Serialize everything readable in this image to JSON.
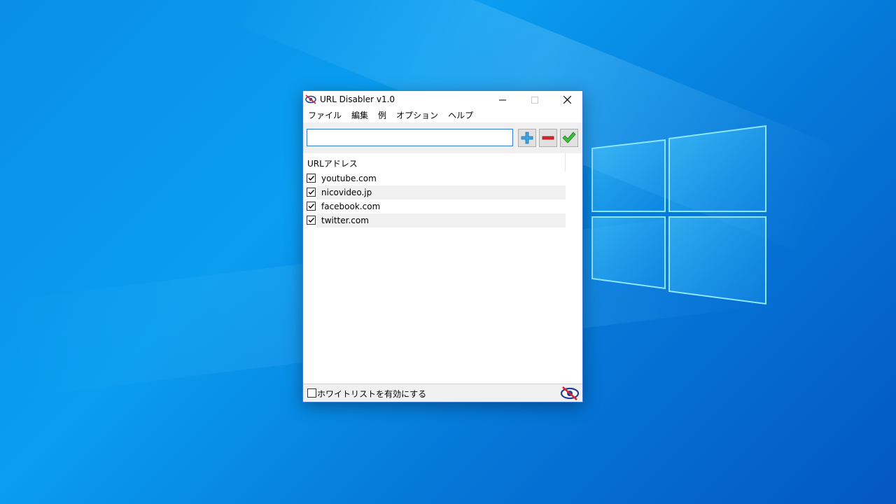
{
  "window": {
    "title": "URL Disabler v1.0"
  },
  "menu": {
    "items": [
      "ファイル",
      "編集",
      "例",
      "オプション",
      "ヘルプ"
    ]
  },
  "toolbar": {
    "url_input_value": "",
    "add_icon": "plus-icon",
    "remove_icon": "minus-icon",
    "apply_icon": "checkmark-icon"
  },
  "list": {
    "column_header": "URLアドレス",
    "rows": [
      {
        "url": "youtube.com",
        "checked": true
      },
      {
        "url": "nicovideo.jp",
        "checked": true
      },
      {
        "url": "facebook.com",
        "checked": true
      },
      {
        "url": "twitter.com",
        "checked": true
      }
    ]
  },
  "status": {
    "whitelist_label": "ホワイトリストを有効にする",
    "whitelist_checked": false
  },
  "colors": {
    "accent": "#2d7bd3",
    "add_icon": "#3aa3e0",
    "remove_icon": "#d9262b",
    "apply_icon": "#3cbf3c"
  }
}
